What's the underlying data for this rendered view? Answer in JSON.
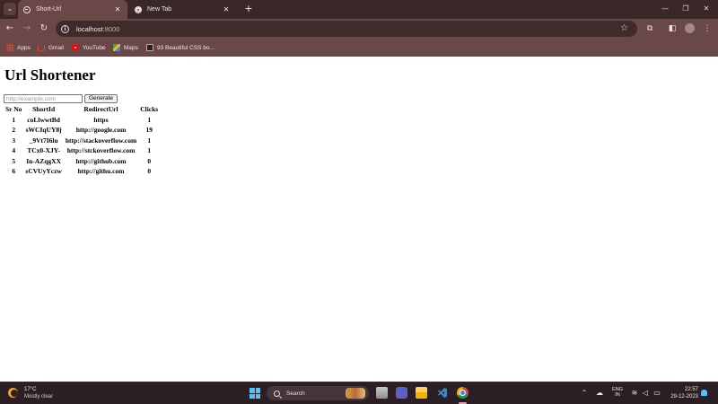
{
  "browser": {
    "tabs": [
      {
        "title": "Short-Url",
        "active": true
      },
      {
        "title": "New Tab",
        "active": false
      }
    ],
    "address": {
      "host": "localhost",
      "port": ":8000"
    },
    "bookmarks": [
      {
        "label": "Apps",
        "icon": "apps-grid-icon"
      },
      {
        "label": "Gmail",
        "icon": "gmail-icon"
      },
      {
        "label": "YouTube",
        "icon": "youtube-icon"
      },
      {
        "label": "Maps",
        "icon": "maps-icon"
      },
      {
        "label": "93 Beautiful CSS bo...",
        "icon": "css-site-icon"
      }
    ]
  },
  "page": {
    "title": "Url Shortener",
    "input": {
      "value": "",
      "placeholder": "http://example.com"
    },
    "generate_label": "Generate",
    "table": {
      "headers": [
        "Sr No",
        "ShortId",
        "RedirectUrl",
        "Clicks"
      ],
      "rows": [
        [
          "1",
          "coLlwwtBd",
          "https",
          "1"
        ],
        [
          "2",
          "sWCIqUY8j",
          "http://google.com",
          "19"
        ],
        [
          "3",
          "_9Vt7I6lu",
          "http://stackoverflow.com",
          "1"
        ],
        [
          "4",
          "TCx0-XJY-",
          "http://stckoverflow.com",
          "1"
        ],
        [
          "5",
          "In-AZqgXX",
          "http://github.com",
          "0"
        ],
        [
          "6",
          "sCVUyYczw",
          "http://githu.com",
          "0"
        ]
      ]
    }
  },
  "taskbar": {
    "weather": {
      "temp": "17°C",
      "desc": "Mostly clear"
    },
    "search_label": "Search",
    "language": {
      "line1": "ENG",
      "line2": "IN"
    },
    "clock": {
      "time": "22:57",
      "date": "29-12-2023"
    }
  },
  "colors": {
    "tabbar": "#3a2727",
    "toolbar": "#6b4848",
    "taskbar": "#2b1f25",
    "accent": "#4cc2ff"
  }
}
